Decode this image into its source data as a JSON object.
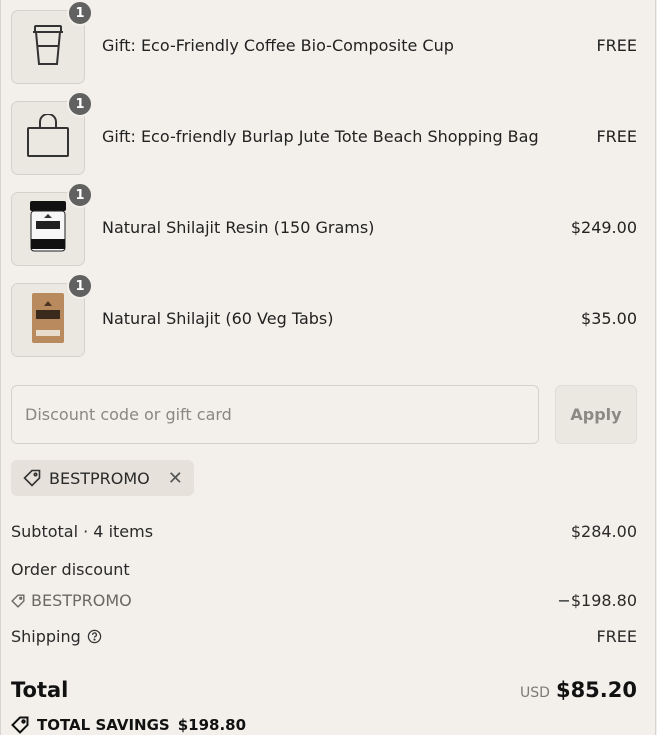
{
  "items": [
    {
      "name": "Gift: Eco-Friendly Coffee Bio-Composite Cup",
      "price": "FREE",
      "qty": "1",
      "icon": "cup-icon"
    },
    {
      "name": "Gift: Eco-friendly Burlap Jute Tote Beach Shopping Bag",
      "price": "FREE",
      "qty": "1",
      "icon": "bag-icon"
    },
    {
      "name": "Natural Shilajit Resin (150 Grams)",
      "price": "$249.00",
      "qty": "1",
      "icon": "resin-jar"
    },
    {
      "name": "Natural Shilajit (60 Veg Tabs)",
      "price": "$35.00",
      "qty": "1",
      "icon": "tabs-pouch"
    }
  ],
  "discount": {
    "placeholder": "Discount code or gift card",
    "apply_label": "Apply"
  },
  "applied_code": {
    "label": "BESTPROMO",
    "remove": "✕"
  },
  "summary": {
    "subtotal_label": "Subtotal · 4 items",
    "subtotal_value": "$284.00",
    "order_discount_label": "Order discount",
    "discount_code": "BESTPROMO",
    "discount_value": "−$198.80",
    "shipping_label": "Shipping",
    "shipping_value": "FREE",
    "total_label": "Total",
    "currency": "USD",
    "total_value": "$85.20",
    "savings_label": "TOTAL SAVINGS",
    "savings_value": "$198.80"
  },
  "colors": {
    "background": "#f3f0eb",
    "badge": "#616161"
  }
}
